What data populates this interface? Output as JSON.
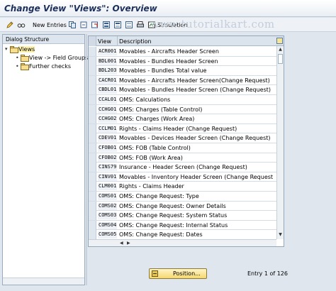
{
  "header": {
    "title": "Change View \"Views\": Overview"
  },
  "toolbar": {
    "new_entries_label": "New Entries",
    "simulation_label": "Simulation",
    "icons": [
      "edit-icon",
      "new-entries-icon",
      "copy-icon",
      "save-local-icon",
      "undo-icon",
      "select-all-icon",
      "deselect-icon",
      "select-block-icon",
      "simulation-icon"
    ]
  },
  "watermark": "www.tutorialkart.com",
  "dialog": {
    "header": "Dialog Structure",
    "tree": [
      {
        "label": "Views",
        "level": 0,
        "selected": true
      },
      {
        "label": "View -> Field Groups",
        "level": 1
      },
      {
        "label": "Further checks",
        "level": 1
      }
    ]
  },
  "table": {
    "columns": {
      "view": "View",
      "description": "Description"
    },
    "rows": [
      {
        "view": "ACR001",
        "description": "Movables - Aircrafts Header Screen"
      },
      {
        "view": "BDL001",
        "description": "Movables - Bundles Header Screen"
      },
      {
        "view": "BDL203",
        "description": "Movables - Bundles Total value"
      },
      {
        "view": "CACR01",
        "description": "Movables - Aircrafts Header Screen(Change Request)"
      },
      {
        "view": "CBDL01",
        "description": "Movables - Bundles Header Screen (Change Request)"
      },
      {
        "view": "CCAL01",
        "description": "OMS: Calculations"
      },
      {
        "view": "CCHG01",
        "description": "OMS: Charges (Table Control)"
      },
      {
        "view": "CCHG02",
        "description": "OMS: Charges (Work Area)"
      },
      {
        "view": "CCLM01",
        "description": "Rights - Claims Header (Change Request)"
      },
      {
        "view": "CDEV01",
        "description": "Movables - Devices Header Screen (Change Request)"
      },
      {
        "view": "CFOB01",
        "description": "OMS: FOB (Table Control)"
      },
      {
        "view": "CFOB02",
        "description": "OMS: FOB (Work Area)"
      },
      {
        "view": "CINS79",
        "description": "Insurance -  Header Screen (Change Request)"
      },
      {
        "view": "CINV01",
        "description": "Movables - Inventory Header Screen (Change Request"
      },
      {
        "view": "CLM001",
        "description": "Rights - Claims Header"
      },
      {
        "view": "COMS01",
        "description": "OMS: Change Request: Type"
      },
      {
        "view": "COMS02",
        "description": "OMS: Change Request: Owner Details"
      },
      {
        "view": "COMS03",
        "description": "OMS: Change Request: System Status"
      },
      {
        "view": "COMS04",
        "description": "OMS: Change Request: Internal Status"
      },
      {
        "view": "COMS05",
        "description": "OMS: Change Request: Dates"
      }
    ]
  },
  "footer": {
    "position_label": "Position...",
    "entry_info": "Entry 1 of 126"
  }
}
